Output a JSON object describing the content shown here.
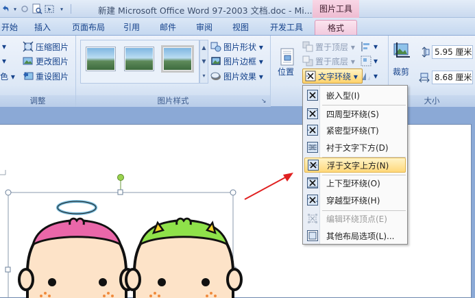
{
  "title_bar": {
    "document_title": "新建 Microsoft Office Word 97-2003 文档.doc - Mi...",
    "context_tab_header": "图片工具"
  },
  "tabs": [
    {
      "label": "开始",
      "active": false
    },
    {
      "label": "插入",
      "active": false
    },
    {
      "label": "页面布局",
      "active": false
    },
    {
      "label": "引用",
      "active": false
    },
    {
      "label": "邮件",
      "active": false
    },
    {
      "label": "审阅",
      "active": false
    },
    {
      "label": "视图",
      "active": false
    },
    {
      "label": "开发工具",
      "active": false
    },
    {
      "label": "格式",
      "active": true
    }
  ],
  "ribbon": {
    "adjust": {
      "label": "调整",
      "partial_items": [
        "",
        "",
        "色 ▾"
      ],
      "compress": "压缩图片",
      "change": "更改图片",
      "reset": "重设图片"
    },
    "picture_styles": {
      "label": "图片样式",
      "shape": "图片形状 ▾",
      "border": "图片边框 ▾",
      "effect": "图片效果 ▾"
    },
    "arrange": {
      "bring_front": "置于顶层 ▾",
      "send_back": "置于底层 ▾",
      "position": "位置",
      "text_wrap": "文字环绕 ▾"
    },
    "size": {
      "label": "大小",
      "crop": "裁剪",
      "height_value": "5.95 厘米",
      "width_value": "8.68 厘米"
    }
  },
  "wrap_menu": {
    "items": [
      {
        "label": "嵌入型(I)",
        "state": "normal"
      },
      {
        "label": "四周型环绕(S)",
        "state": "normal"
      },
      {
        "label": "紧密型环绕(T)",
        "state": "normal"
      },
      {
        "label": "衬于文字下方(D)",
        "state": "normal"
      },
      {
        "label": "浮于文字上方(N)",
        "state": "hover"
      },
      {
        "label": "上下型环绕(O)",
        "state": "normal"
      },
      {
        "label": "穿越型环绕(H)",
        "state": "normal"
      },
      {
        "label": "编辑环绕顶点(E)",
        "state": "disabled"
      },
      {
        "label": "其他布局选项(L)...",
        "state": "normal"
      }
    ]
  },
  "colors": {
    "ribbon_text": "#15428b",
    "context_tab": "#f2cade",
    "hover_highlight": "#ffd87a",
    "arrow": "#e02020"
  }
}
